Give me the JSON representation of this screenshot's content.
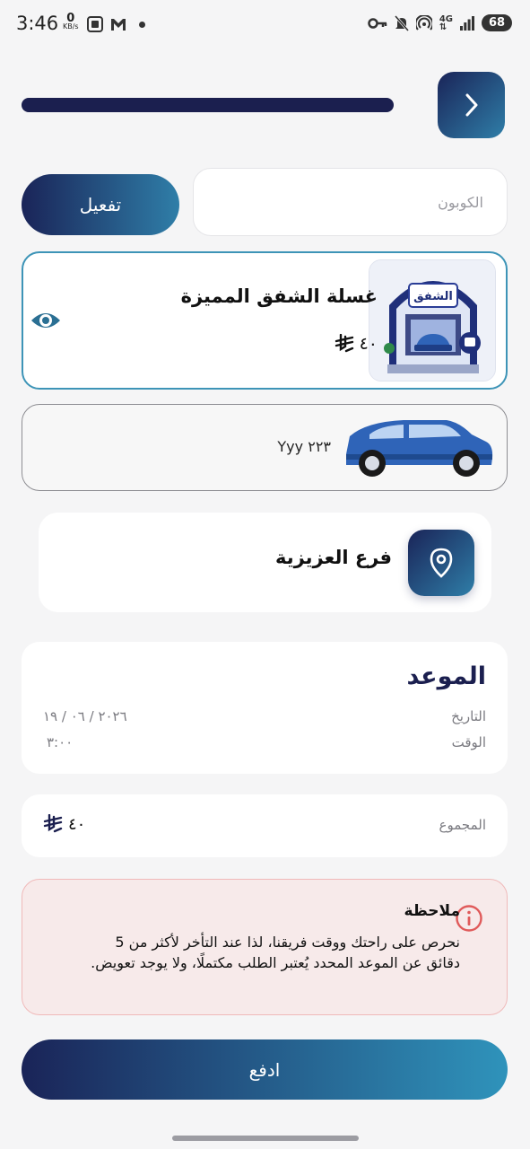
{
  "status_bar": {
    "time": "3:46",
    "data_rate_value": "0",
    "data_rate_unit": "KB/s",
    "network": "4G",
    "battery": "68"
  },
  "header": {
    "back_icon": "chevron-right-icon"
  },
  "coupon": {
    "placeholder": "الكوبون",
    "activate_label": "تفعيل"
  },
  "service": {
    "title": "غسلة الشفق المميزة",
    "price": "٤٠",
    "currency_icon": "riyal-symbol-icon",
    "image_logo_text": "الشفق"
  },
  "car": {
    "plate": "٢٢٣ Yyy",
    "color": "#2f64b8"
  },
  "branch": {
    "name": "فرع العزيزية",
    "icon": "location-pin-icon"
  },
  "appointment": {
    "title": "الموعد",
    "date_label": "التاريخ",
    "date_value": "٢٠٢٦ / ٠٦ / ١٩",
    "time_label": "الوقت",
    "time_value": "٣:٠٠"
  },
  "total": {
    "label": "المجموع",
    "value": "٤٠"
  },
  "note": {
    "title": "ملاحظة",
    "body": "نحرص على راحتك ووقت فريقنا، لذا عند التأخر لأكثر من 5 دقائق عن الموعد المحدد يُعتبر الطلب مكتملًا، ولا يوجد تعويض."
  },
  "pay": {
    "label": "ادفع"
  },
  "colors": {
    "primary_dark": "#1a2458",
    "primary_light": "#2f7ea8",
    "card_border_selected": "#3d94b7",
    "note_background": "#f7eaea",
    "note_icon": "#e05a5a"
  }
}
